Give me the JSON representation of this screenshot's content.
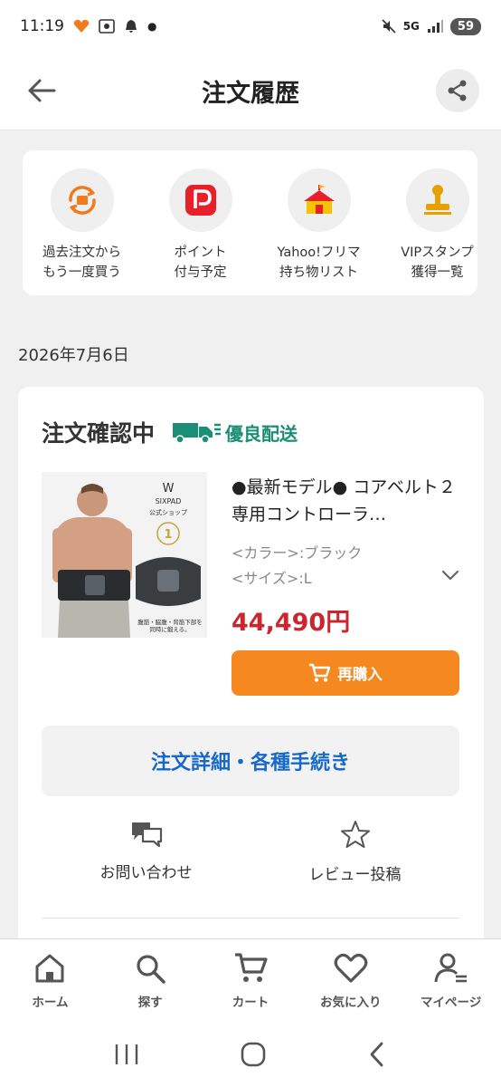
{
  "status_bar": {
    "time": "11:19",
    "network": "5G",
    "battery": "59"
  },
  "header": {
    "title": "注文履歴",
    "back_icon": "arrow-left-icon",
    "share_icon": "share-icon"
  },
  "quick_links": [
    {
      "line1": "過去注文から",
      "line2": "もう一度買う",
      "icon": "reorder-cycle-icon",
      "color": "#f07a1c"
    },
    {
      "line1": "ポイント",
      "line2": "付与予定",
      "icon": "paypay-points-icon",
      "color": "#e8202a"
    },
    {
      "line1": "Yahoo!フリマ",
      "line2": "持ち物リスト",
      "icon": "tent-icon",
      "color": "#e8202a"
    },
    {
      "line1": "VIPスタンプ",
      "line2": "獲得一覧",
      "icon": "stamp-icon",
      "color": "#e8a000"
    }
  ],
  "order": {
    "date": "2026年7月6日",
    "status": "注文確認中",
    "shipping_badge": "優良配送",
    "product_title": "●最新モデル● コアベルト２専用コントローラ…",
    "color_attr": "<カラー>:ブラック",
    "size_attr": "<サイズ>:L",
    "price": "44,490円",
    "rebuy_label": "再購入",
    "detail_label": "注文詳細・各種手続き",
    "contact_label": "お問い合わせ",
    "review_label": "レビュー投稿",
    "image_brand": "SIXPAD",
    "image_shop": "公式ショップ",
    "image_caption": "腹筋・脇腹・背筋下部を\n同時に鍛える。"
  },
  "bottom_nav": [
    {
      "label": "ホーム",
      "icon": "home-icon"
    },
    {
      "label": "探す",
      "icon": "search-icon"
    },
    {
      "label": "カート",
      "icon": "cart-icon"
    },
    {
      "label": "お気に入り",
      "icon": "heart-icon"
    },
    {
      "label": "マイページ",
      "icon": "user-icon"
    }
  ],
  "colors": {
    "accent_orange": "#f5891f",
    "price_red": "#c8282d",
    "link_blue": "#1669c9",
    "shipping_green": "#1a8f76"
  }
}
